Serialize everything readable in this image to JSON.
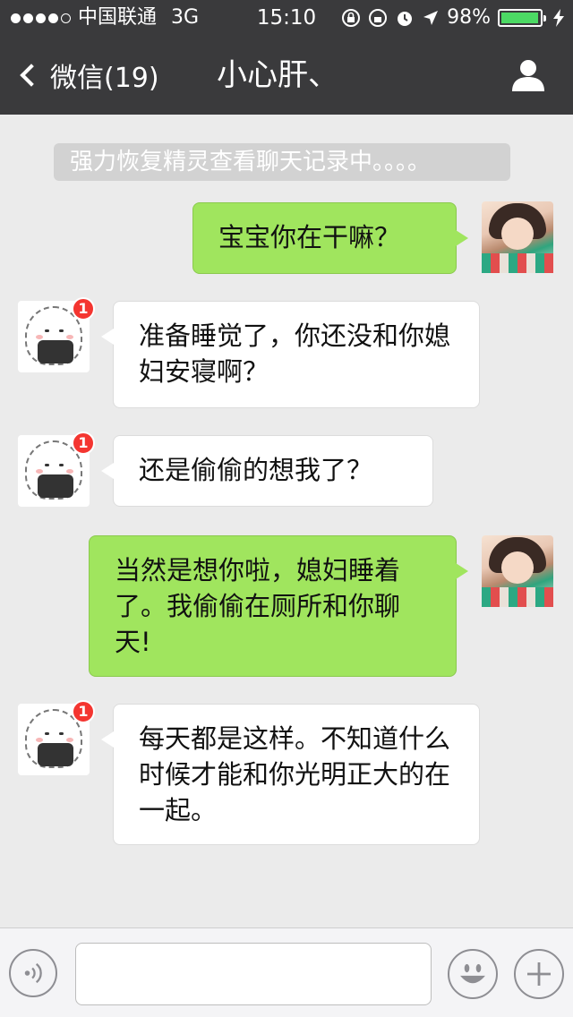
{
  "status_bar": {
    "carrier": "中国联通",
    "network": "3G",
    "time": "15:10",
    "battery_text": "98%",
    "battery_level": 0.98,
    "battery_color": "#4cd964",
    "icons": [
      "lock-rotation-icon",
      "alarm-icon",
      "location-arrow-icon",
      "charging-icon"
    ]
  },
  "nav": {
    "back_label": "微信(19)",
    "title": "小心肝、",
    "profile_icon": "person-icon"
  },
  "system_notice": "强力恢复精灵查看聊天记录中。。。。",
  "messages": [
    {
      "from": "me",
      "text": "宝宝你在干嘛？"
    },
    {
      "from": "them",
      "text": "准备睡觉了，你还没和你媳妇安寝啊？",
      "badge": "1"
    },
    {
      "from": "them",
      "text": "还是偷偷的想我了？",
      "badge": "1"
    },
    {
      "from": "me",
      "text": "当然是想你啦，媳妇睡着了。我偷偷在厕所和你聊天!"
    },
    {
      "from": "them",
      "text": "每天都是这样。不知道什么时候才能和你光明正大的在一起。",
      "badge": "1"
    }
  ],
  "input_bar": {
    "value": "",
    "icons": [
      "voice-icon",
      "emoji-icon",
      "plus-icon"
    ]
  },
  "colors": {
    "topbar": "#3a3a3c",
    "my_bubble": "#a0e55e",
    "their_bubble": "#ffffff",
    "background": "#ebebeb",
    "badge": "#f43530"
  }
}
